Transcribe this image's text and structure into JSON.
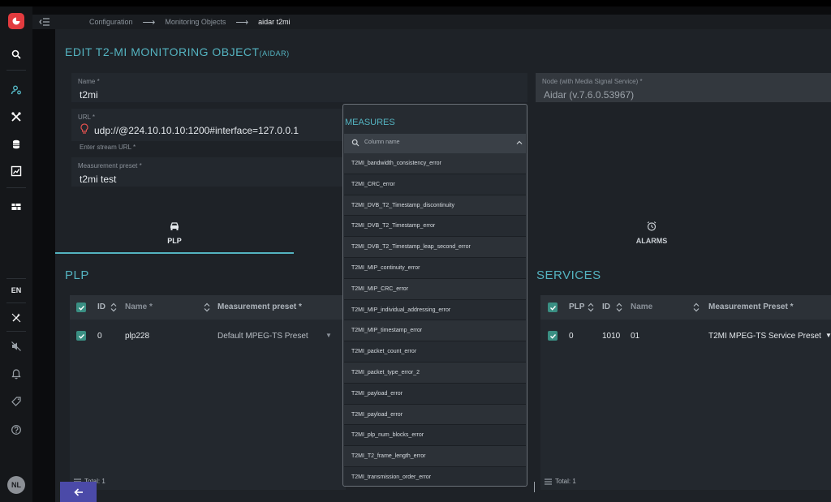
{
  "breadcrumb": {
    "items": [
      "Configuration",
      "Monitoring Objects"
    ],
    "current": "aidar t2mi"
  },
  "page": {
    "title": "EDIT T2-MI MONITORING OBJECT",
    "title_suffix": "(AIDAR)"
  },
  "form": {
    "name_label": "Name *",
    "name_value": "t2mi",
    "node_label": "Node (with Media Signal Service) *",
    "node_value": "Aidar (v.7.6.0.53967)",
    "url_label": "URL *",
    "url_value": "udp://@224.10.10.10:1200#interface=127.0.0.1",
    "url_hint": "Enter stream URL *",
    "preset_label": "Measurement preset *",
    "preset_value": "t2mi test"
  },
  "tabs": [
    {
      "label": "PLP",
      "icon": "car-icon",
      "active": true
    },
    {
      "label": "ALARMS",
      "icon": "alarm-clock-icon",
      "active": false
    }
  ],
  "plp": {
    "title": "PLP",
    "columns": [
      "ID",
      "Name *",
      "Measurement preset *"
    ],
    "rows": [
      {
        "id": "0",
        "name": "plp228",
        "preset": "Default MPEG-TS Preset"
      }
    ],
    "total_label": "Total: 1"
  },
  "services": {
    "title": "SERVICES",
    "columns": [
      "PLP",
      "ID",
      "Name",
      "Measurement Preset *"
    ],
    "rows": [
      {
        "plp": "0",
        "id": "1010",
        "name": "01",
        "preset": "T2MI MPEG-TS Service Preset"
      }
    ],
    "total_label": "Total: 1"
  },
  "measures_popup": {
    "title": "MEASURES",
    "search_placeholder": "Column name",
    "items": [
      "T2MI_bandwidth_consistency_error",
      "T2MI_CRC_error",
      "T2MI_DVB_T2_Timestamp_discontinuity",
      "T2MI_DVB_T2_Timestamp_error",
      "T2MI_DVB_T2_Timestamp_leap_second_error",
      "T2MI_MIP_continuity_error",
      "T2MI_MIP_CRC_error",
      "T2MI_MIP_individual_addressing_error",
      "T2MI_MIP_timestamp_error",
      "T2MI_packet_count_error",
      "T2MI_packet_type_error_2",
      "T2MI_payload_error",
      "T2MI_payload_error",
      "T2MI_plp_num_blocks_error",
      "T2MI_T2_frame_length_error",
      "T2MI_transmission_order_error"
    ]
  },
  "sidebar": {
    "language": "EN",
    "avatar_initials": "NL"
  },
  "colors": {
    "accent": "#54b3c0",
    "logo": "#e23b3f",
    "checkbox": "#3a8f83",
    "back_button": "#4b4aa8"
  }
}
